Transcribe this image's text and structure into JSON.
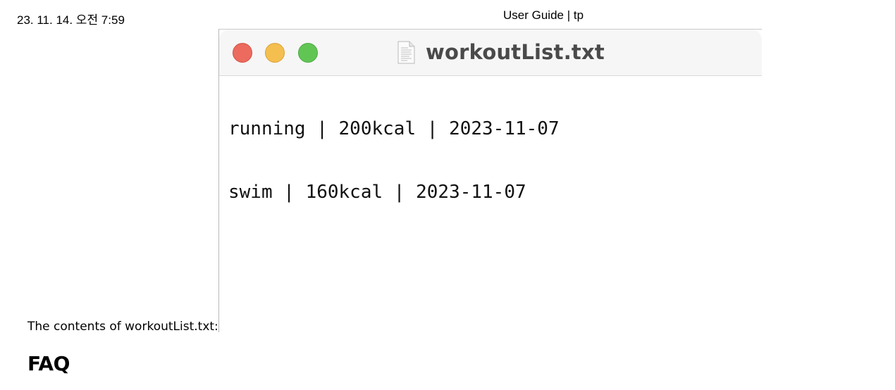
{
  "print_header": {
    "datetime": "23. 11. 14. 오전 7:59",
    "page_title": "User Guide | tp"
  },
  "window": {
    "title": "workoutList.txt",
    "icon": "text-document-icon",
    "controls": {
      "close": "close-button",
      "minimize": "minimize-button",
      "zoom": "zoom-button"
    },
    "colors": {
      "close": "#ec6a5e",
      "minimize": "#f4bf4f",
      "zoom": "#61c554",
      "titlebar": "#f6f6f6"
    },
    "lines": [
      "running | 200kcal | 2023-11-07",
      "swim | 160kcal | 2023-11-07"
    ]
  },
  "caption": "The contents of workoutList.txt:",
  "section_heading": "FAQ"
}
